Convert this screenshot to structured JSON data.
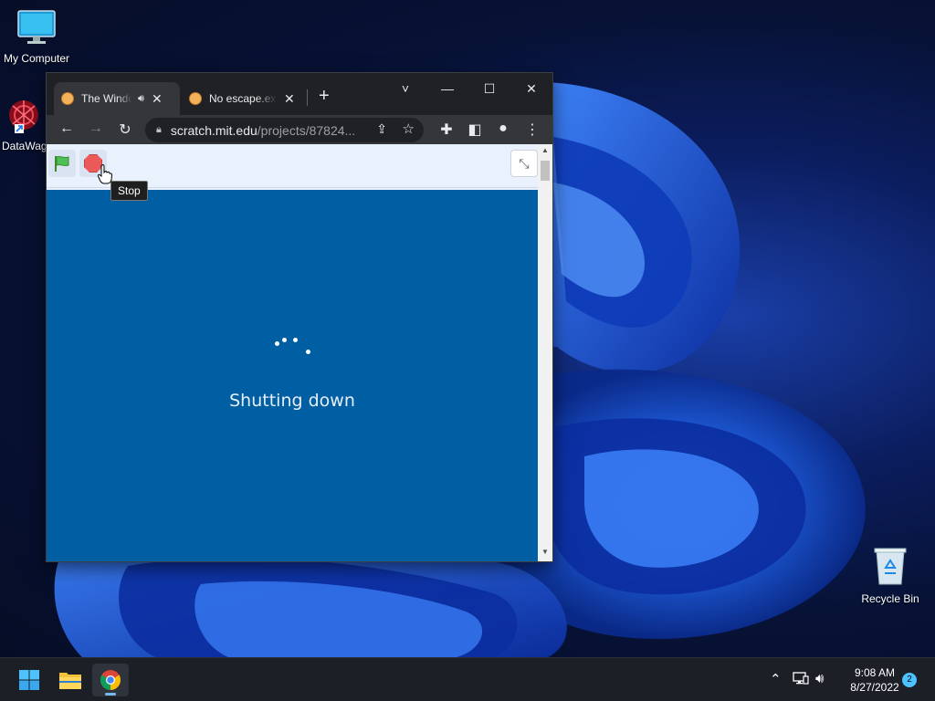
{
  "desktop": {
    "icons": [
      {
        "label": "My Computer"
      },
      {
        "label": "DataWag"
      },
      {
        "label": "Recycle Bin"
      }
    ]
  },
  "browser": {
    "tabs": [
      {
        "title": "The Windows",
        "audio_icon": "speaker-icon",
        "active": true
      },
      {
        "title": "No escape.exe",
        "active": false
      }
    ],
    "new_tab_label": "+",
    "window_controls": {
      "dropdown": "˅",
      "minimize": "—",
      "maximize": "☐",
      "close": "✕"
    },
    "address": {
      "domain": "scratch.mit.edu",
      "path": "/projects/87824..."
    },
    "accent_color": "#35363a"
  },
  "scratch": {
    "tooltip": "Stop",
    "stage_status": "Shutting down",
    "stage_color": "#005ea3"
  },
  "taskbar": {
    "clock_time": "9:08 AM",
    "clock_date": "8/27/2022",
    "notification_count": "2"
  }
}
